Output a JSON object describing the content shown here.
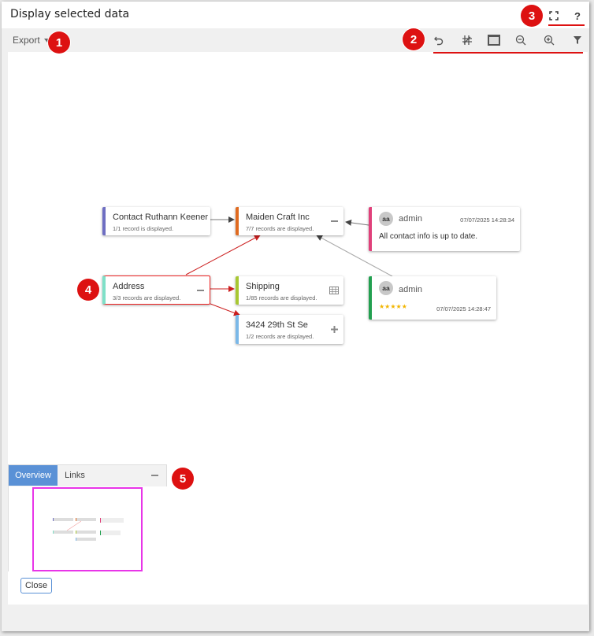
{
  "window": {
    "title": "Display selected data",
    "help_label": "?"
  },
  "toolbar": {
    "export_label": "Export",
    "tools": [
      "undo-icon",
      "layout-icon",
      "fit-screen-icon",
      "zoom-out-icon",
      "zoom-in-icon",
      "filter-icon"
    ]
  },
  "nodes": {
    "contact": {
      "title": "Contact Ruthann Keener",
      "subtitle": "1/1 record is displayed.",
      "color": "#6e6ec2"
    },
    "company": {
      "title": "Maiden Craft Inc",
      "subtitle": "7/7 records are displayed.",
      "color": "#e06b20"
    },
    "address": {
      "title": "Address",
      "subtitle": "3/3 records are displayed.",
      "color": "#7fe0c8"
    },
    "shipping": {
      "title": "Shipping",
      "subtitle": "1/85 records are displayed.",
      "color": "#a8c832"
    },
    "street": {
      "title": "3424 29th St Se",
      "subtitle": "1/2 records are displayed.",
      "color": "#7ab8e8"
    }
  },
  "comments": [
    {
      "avatar": "aa",
      "author": "admin",
      "date": "07/07/2025 14:28:34",
      "text": "All contact info is up to date.",
      "color": "#e0407a"
    },
    {
      "avatar": "aa",
      "author": "admin",
      "date": "07/07/2025 14:28:47",
      "stars": "★★★★★",
      "rating": 5,
      "color": "#22a050"
    }
  ],
  "overview": {
    "tab_overview": "Overview",
    "tab_links": "Links"
  },
  "buttons": {
    "close_label": "Close"
  },
  "badges": [
    "1",
    "2",
    "3",
    "4",
    "5"
  ],
  "colors": {
    "accent": "#5a91d6",
    "callout": "#dd1111",
    "viewport_frame": "#e835e8"
  }
}
